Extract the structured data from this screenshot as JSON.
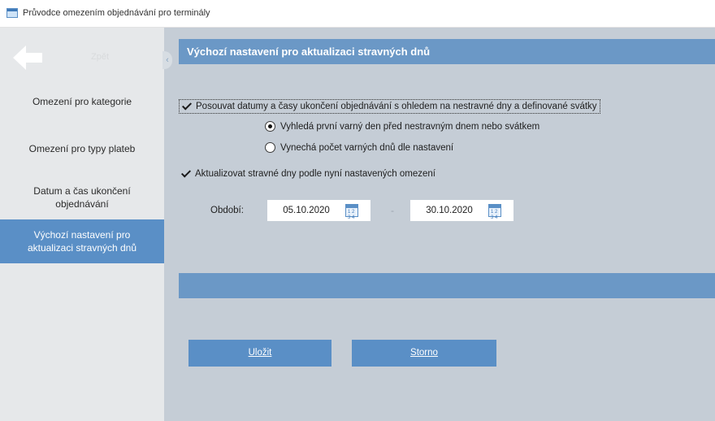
{
  "window": {
    "title": "Průvodce omezením objednávání pro terminály",
    "icon": "app-window-icon"
  },
  "sidebar": {
    "back_icon": "arrow-left-icon",
    "ghost_text": "Zpět",
    "collapse_icon": "chevron-left-icon",
    "items": [
      {
        "label": "Omezení pro kategorie",
        "active": false
      },
      {
        "label": "Omezení pro typy plateb",
        "active": false
      },
      {
        "label": "Datum a čas ukončení objednávání",
        "active": false
      },
      {
        "label": "Výchozí nastavení pro aktualizaci stravných dnů",
        "active": true
      }
    ]
  },
  "main": {
    "header": "Výchozí nastavení pro aktualizaci stravných dnů",
    "shift_checkbox": {
      "label": "Posouvat datumy a časy ukončení objednávání s ohledem na nestravné dny a definované svátky",
      "checked": true
    },
    "radio_options": [
      {
        "label": "Vyhledá první varný den před nestravným dnem nebo svátkem",
        "selected": true
      },
      {
        "label": "Vynechá počet varných dnů dle nastavení",
        "selected": false
      }
    ],
    "update_checkbox": {
      "label": "Aktualizovat stravné dny podle nyní nastavených omezení",
      "checked": true
    },
    "period": {
      "label": "Období:",
      "from": "05.10.2020",
      "to": "30.10.2020",
      "separator": "-",
      "calendar_icon": "calendar-icon",
      "calendar_icon_text": "1 2 3 4"
    },
    "buttons": {
      "save": "Uložit",
      "cancel": "Storno"
    }
  },
  "colors": {
    "accent": "#5a8fc6",
    "header_bar": "#6b98c6",
    "sidebar_bg": "#e6e8ea",
    "content_bg": "#c5cdd6"
  }
}
